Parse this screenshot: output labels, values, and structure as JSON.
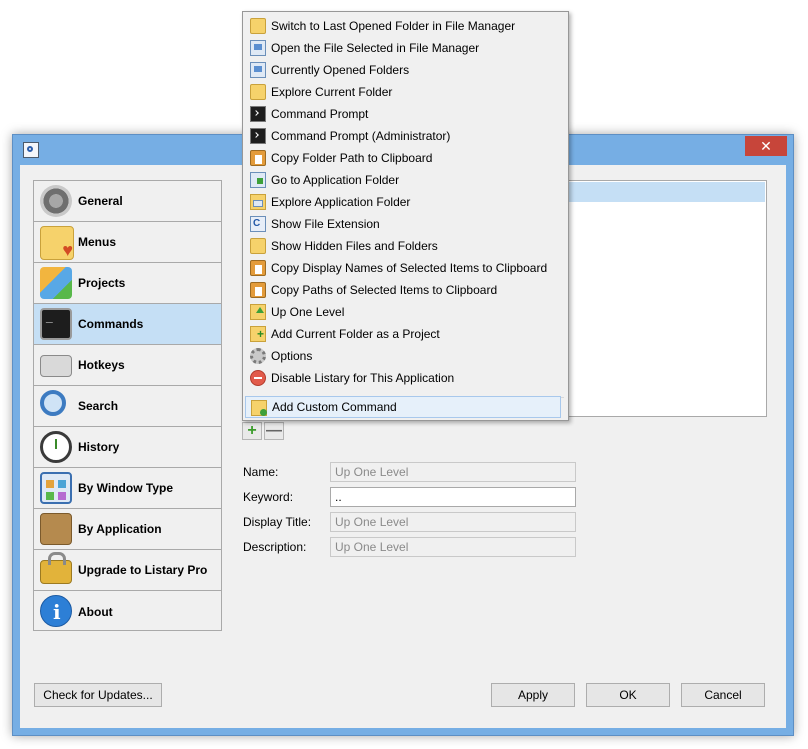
{
  "window": {
    "close_label": "✕"
  },
  "sidebar": {
    "items": [
      {
        "label": "General",
        "icon": "gear-icon"
      },
      {
        "label": "Menus",
        "icon": "folder-heart-icon"
      },
      {
        "label": "Projects",
        "icon": "boxes-icon"
      },
      {
        "label": "Commands",
        "icon": "terminal-icon",
        "selected": true
      },
      {
        "label": "Hotkeys",
        "icon": "keyboard-icon"
      },
      {
        "label": "Search",
        "icon": "magnifier-icon"
      },
      {
        "label": "History",
        "icon": "clock-icon"
      },
      {
        "label": "By Window Type",
        "icon": "windows-icon"
      },
      {
        "label": "By Application",
        "icon": "box-icon"
      },
      {
        "label": "Upgrade to Listary Pro",
        "icon": "lock-icon"
      },
      {
        "label": "About",
        "icon": "info-icon"
      }
    ]
  },
  "list": {
    "add_label": "+",
    "remove_label": "—"
  },
  "form": {
    "name_label": "Name:",
    "name_value": "Up One Level",
    "keyword_label": "Keyword:",
    "keyword_value": "..",
    "display_title_label": "Display Title:",
    "display_title_value": "Up One Level",
    "description_label": "Description:",
    "description_value": "Up One Level"
  },
  "buttons": {
    "check_updates": "Check for Updates...",
    "apply": "Apply",
    "ok": "OK",
    "cancel": "Cancel"
  },
  "menu": {
    "items": [
      "Switch to Last Opened Folder in File Manager",
      "Open the File Selected in File Manager",
      "Currently Opened Folders",
      "Explore Current Folder",
      "Command Prompt",
      "Command Prompt (Administrator)",
      "Copy Folder Path to Clipboard",
      "Go to Application Folder",
      "Explore Application Folder",
      "Show File Extension",
      "Show Hidden Files and Folders",
      "Copy Display Names of Selected Items to Clipboard",
      "Copy Paths of Selected Items to Clipboard",
      "Up One Level",
      "Add Current Folder as a Project",
      "Options",
      "Disable Listary for This Application"
    ],
    "custom_item": "Add Custom Command"
  }
}
